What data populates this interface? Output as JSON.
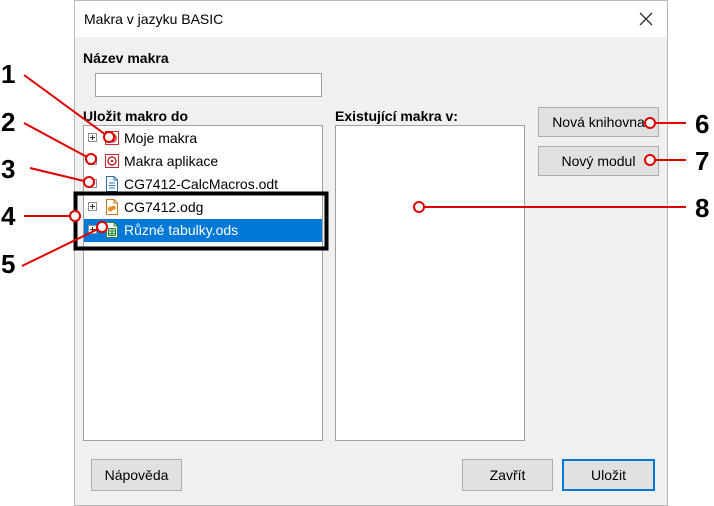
{
  "window": {
    "title": "Makra v jazyku BASIC"
  },
  "form": {
    "macro_name_label": "Název makra",
    "macro_name_value": "",
    "save_in_label": "Uložit makro do",
    "existing_label": "Existující makra v:"
  },
  "tree": {
    "items": [
      {
        "label": "Moje makra",
        "icon": "macro-library-icon",
        "selected": false
      },
      {
        "label": "Makra aplikace",
        "icon": "macro-library-icon",
        "selected": false
      },
      {
        "label": "CG7412-CalcMacros.odt",
        "icon": "writer-document-icon",
        "selected": false
      },
      {
        "label": "CG7412.odg",
        "icon": "draw-document-icon",
        "selected": false
      },
      {
        "label": "Různé tabulky.ods",
        "icon": "calc-document-icon",
        "selected": true
      }
    ]
  },
  "buttons": {
    "new_library": "Nová knihovna",
    "new_module": "Nový modul",
    "help": "Nápověda",
    "close": "Zavřít",
    "save": "Uložit"
  },
  "callouts": [
    "1",
    "2",
    "3",
    "4",
    "5",
    "6",
    "7",
    "8"
  ],
  "colors": {
    "callout": "#e00000",
    "selection": "#0078d7",
    "highlight_box": "#000000"
  }
}
